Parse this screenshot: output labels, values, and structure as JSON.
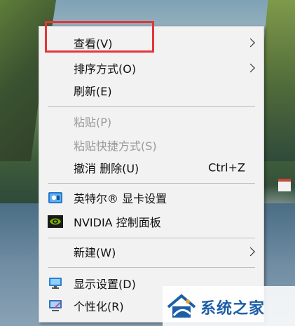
{
  "menu": {
    "items": [
      {
        "label": "查看(V)",
        "submenu": true
      },
      {
        "label": "排序方式(O)",
        "submenu": true
      },
      {
        "label": "刷新(E)"
      },
      {
        "label": "粘贴(P)",
        "disabled": true
      },
      {
        "label": "粘贴快捷方式(S)",
        "disabled": true
      },
      {
        "label": "撤消 删除(U)",
        "shortcut": "Ctrl+Z"
      },
      {
        "label": "英特尔® 显卡设置",
        "icon": "intel-graphics-icon"
      },
      {
        "label": "NVIDIA 控制面板",
        "icon": "nvidia-icon"
      },
      {
        "label": "新建(W)",
        "submenu": true
      },
      {
        "label": "显示设置(D)",
        "icon": "display-settings-icon"
      },
      {
        "label": "个性化(R)",
        "icon": "personalize-icon"
      }
    ]
  },
  "watermark": {
    "text": "系统之家"
  },
  "colors": {
    "highlight": "#e5353a",
    "menu_bg": "#f2f2f2",
    "disabled_text": "#9a9a9a",
    "watermark_text": "#1d5fa6"
  }
}
